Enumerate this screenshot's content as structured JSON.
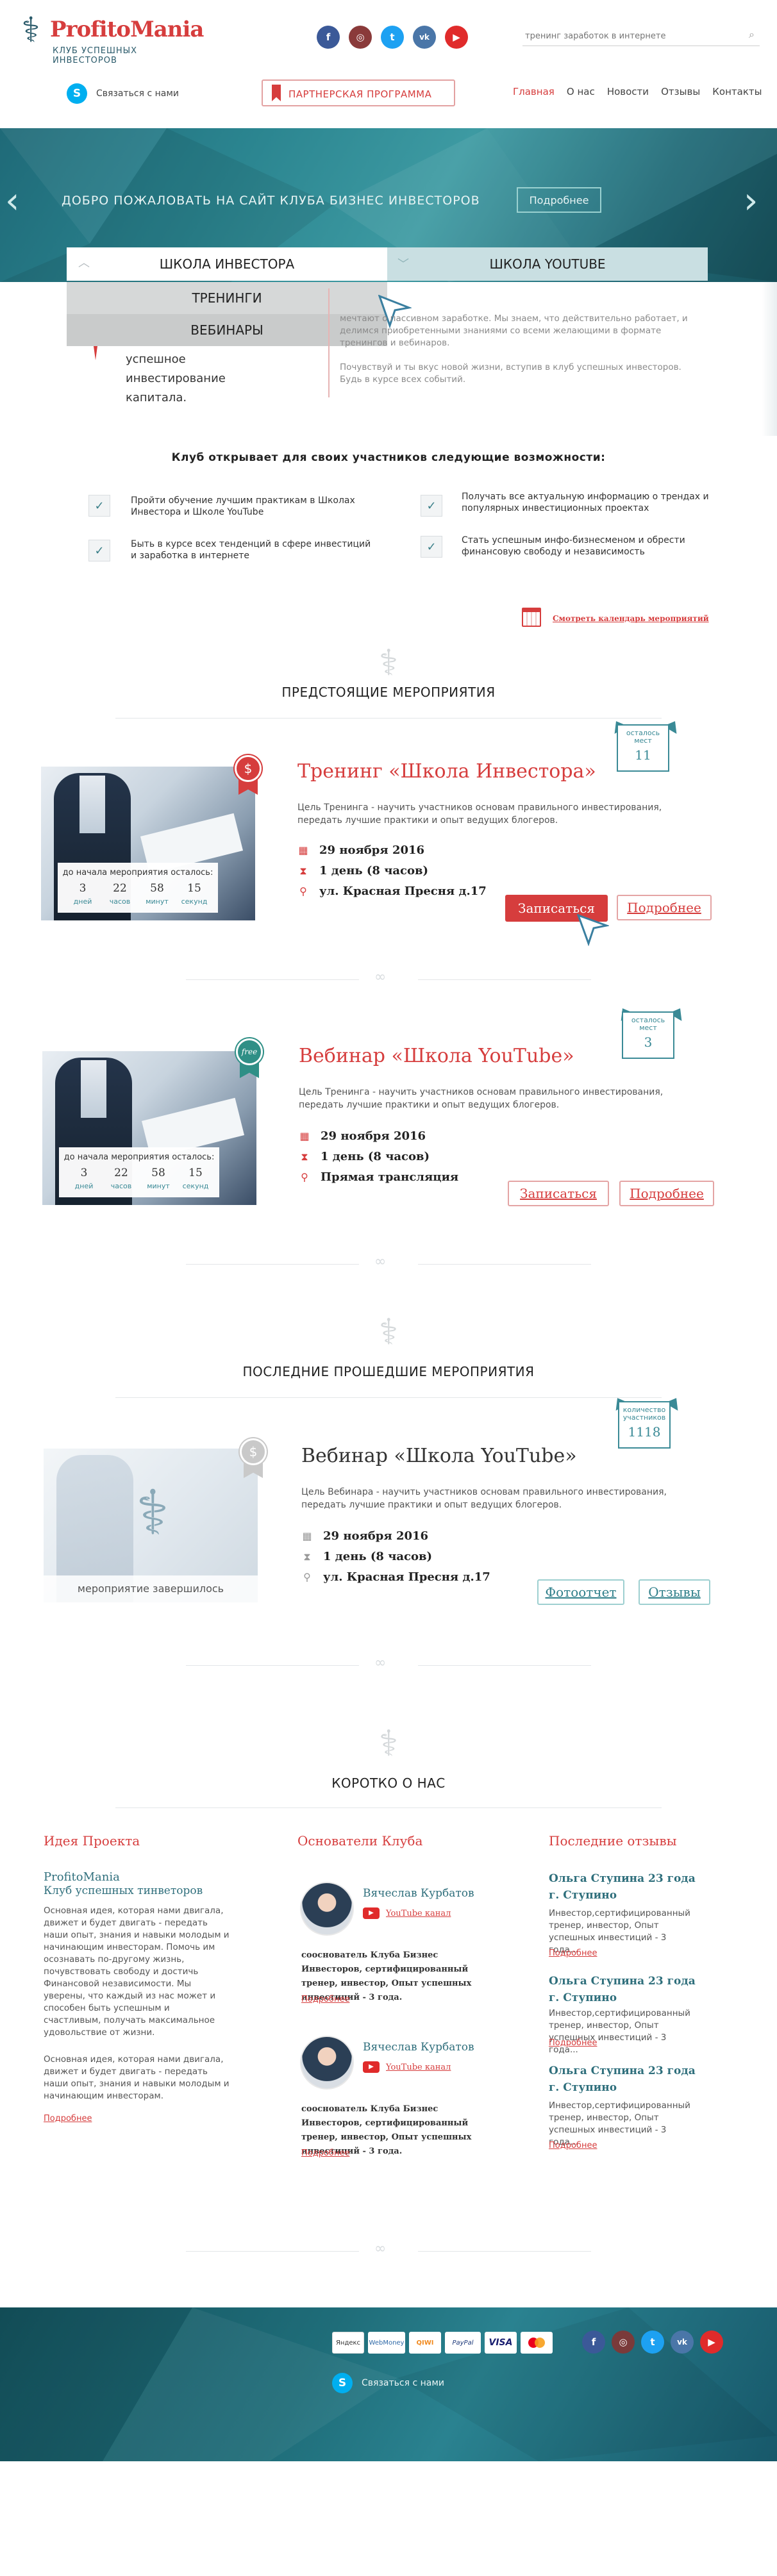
{
  "header": {
    "logo_title": "ProfitoMania",
    "logo_subtitle": "КЛУБ УСПЕШНЫХ ИНВЕСТОРОВ",
    "search_placeholder": "тренинг заработок в интернете",
    "skype_label": "Связаться с нами",
    "partner_button": "ПАРТНЕРСКАЯ ПРОГРАММА",
    "nav": [
      "Главная",
      "О нас",
      "Новости",
      "Отзывы",
      "Контакты"
    ],
    "social": [
      "f",
      "ig",
      "t",
      "vk",
      "yt"
    ]
  },
  "hero": {
    "title": "ДОБРО ПОЖАЛОВАТЬ НА САЙТ КЛУБА БИЗНЕС ИНВЕСТОРОВ",
    "button": "Подробнее"
  },
  "tabs": {
    "tab1": "ШКОЛА ИНВЕСТОРА",
    "tab2": "ШКОЛА YOUTUBE",
    "dropdown": [
      "ТРЕНИНГИ",
      "ВЕБИНАРЫ"
    ]
  },
  "intro": {
    "left_text": "успешное инвестирование капитала.",
    "right_text_1": "мечтают о пассивном заработке. Мы знаем, что действительно работает, и делимся приобретенными знаниями со всеми желающими в формате тренингов и вебинаров.",
    "right_text_2": "Почувствуй и ты вкус новой жизни, вступив в клуб успешных инвесторов. Будь в курсе всех событий."
  },
  "features": {
    "title": "Клуб открывает для своих участников следующие возможности:",
    "items": [
      "Пройти обучение лучшим практикам в Школах Инвестора и Школе YouTube",
      "Получать все актуальную информацию о трендах и популярных инвестиционных проектах",
      "Быть в курсе всех тенденций в сфере инвестиций и заработка в интернете",
      "Стать успешным инфо-бизнесменом и обрести финансовую свободу и независимость"
    ],
    "calendar_link": "Смотреть календарь мероприятий"
  },
  "upcoming": {
    "title": "ПРЕДСТОЯЩИЕ МЕРОПРИЯТИЯ",
    "events": [
      {
        "badge": "$",
        "ribbon_label": "осталось мест",
        "ribbon_value": "11",
        "title": "Тренинг «Школа Инвестора»",
        "desc": "Цель Тренинга - научить участников основам правильного инвестирования, передать лучшие практики и опыт ведущих блогеров.",
        "date": "29 ноября 2016",
        "duration": "1 день (8 часов)",
        "location": "ул. Красная Пресня д.17",
        "countdown_title": "до начала мероприятия осталось:",
        "countdown": [
          {
            "n": "3",
            "l": "дней"
          },
          {
            "n": "22",
            "l": "часов"
          },
          {
            "n": "58",
            "l": "минут"
          },
          {
            "n": "15",
            "l": "секунд"
          }
        ],
        "btn_signup": "Записаться",
        "btn_more": "Подробнее"
      },
      {
        "badge": "free",
        "ribbon_label": "осталось мест",
        "ribbon_value": "3",
        "title": "Вебинар «Школа YouTube»",
        "desc": "Цель Тренинга - научить участников основам правильного инвестирования, передать лучшие практики и опыт ведущих блогеров.",
        "date": "29 ноября 2016",
        "duration": "1 день (8 часов)",
        "location": "Прямая трансляция",
        "countdown_title": "до начала мероприятия осталось:",
        "countdown": [
          {
            "n": "3",
            "l": "дней"
          },
          {
            "n": "22",
            "l": "часов"
          },
          {
            "n": "58",
            "l": "минут"
          },
          {
            "n": "15",
            "l": "секунд"
          }
        ],
        "btn_signup": "Записаться",
        "btn_more": "Подробнее"
      }
    ]
  },
  "past": {
    "title": "ПОСЛЕДНИЕ ПРОШЕДШИЕ МЕРОПРИЯТИЯ",
    "event": {
      "badge": "$",
      "ribbon_label": "количество участников",
      "ribbon_value": "1118",
      "title": "Вебинар «Школа YouTube»",
      "desc": "Цель Вебинара - научить участников основам правильного инвестирования, передать лучшие практики и опыт ведущих блогеров.",
      "date": "29 ноября 2016",
      "duration": "1 день (8 часов)",
      "location": "ул. Красная Пресня д.17",
      "finished": "мероприятие завершилось",
      "btn_photo": "Фотоотчет",
      "btn_reviews": "Отзывы"
    }
  },
  "about": {
    "title": "КОРОТКО О НАС",
    "idea": {
      "heading": "Идея Проекта",
      "subtitle_1": "ProfitoMania",
      "subtitle_2": "Клуб успешных тинветоров",
      "text_1": "Основная идея, которая нами двигала, движет и будет двигать - передать наши опыт, знания и навыки молодым и начинающим инвесторам. Помочь им осознавать по-другому жизнь, почувствовать свободу и достичь Финансовой независимости. Мы уверены, что каждый из нас может и способен быть успешным и счастливым, получать максимальное удовольствие от жизни.",
      "text_2": "Основная идея, которая нами двигала, движет и будет двигать - передать наши опыт, знания и навыки молодым и начинающим инвесторам.",
      "more": "Подробнее"
    },
    "founders": {
      "heading": "Основатели Клуба",
      "people": [
        {
          "name": "Вячеслав Курбатов",
          "channel": "YouTube канал",
          "bio": "сооснователь Клуба Бизнес Инвесторов, сертифицированный тренер, инвестор, Опыт успешных инвестиций - 3 года.",
          "more": "Подробнее"
        },
        {
          "name": "Вячеслав Курбатов",
          "channel": "YouTube канал",
          "bio": "сооснователь Клуба Бизнес Инвесторов, сертифицированный тренер, инвестор, Опыт успешных инвестиций - 3 года.",
          "more": "Подробнее"
        }
      ]
    },
    "reviews": {
      "heading": "Последние отзывы",
      "items": [
        {
          "name": "Ольга Ступина 23 года г. Ступино",
          "text": "Инвестор,сертифицированный тренер, инвестор, Опыт успешных инвестиций - 3 года...",
          "more": "Подробнее"
        },
        {
          "name": "Ольга Ступина 23 года г. Ступино",
          "text": "Инвестор,сертифицированный тренер, инвестор, Опыт успешных инвестиций - 3 года...",
          "more": "Подробнее"
        },
        {
          "name": "Ольга Ступина 23 года г. Ступино",
          "text": "Инвестор,сертифицированный тренер, инвестор, Опыт успешных инвестиций - 3 года...",
          "more": "Подробнее"
        }
      ]
    }
  },
  "footer": {
    "payments": [
      "Яндекс",
      "WebMoney",
      "QIWI",
      "PayPal",
      "VISA",
      "MC"
    ],
    "skype_label": "Связаться с нами"
  },
  "colors": {
    "accent": "#d63d3d",
    "teal": "#2b8590",
    "dark_teal": "#14535e"
  }
}
